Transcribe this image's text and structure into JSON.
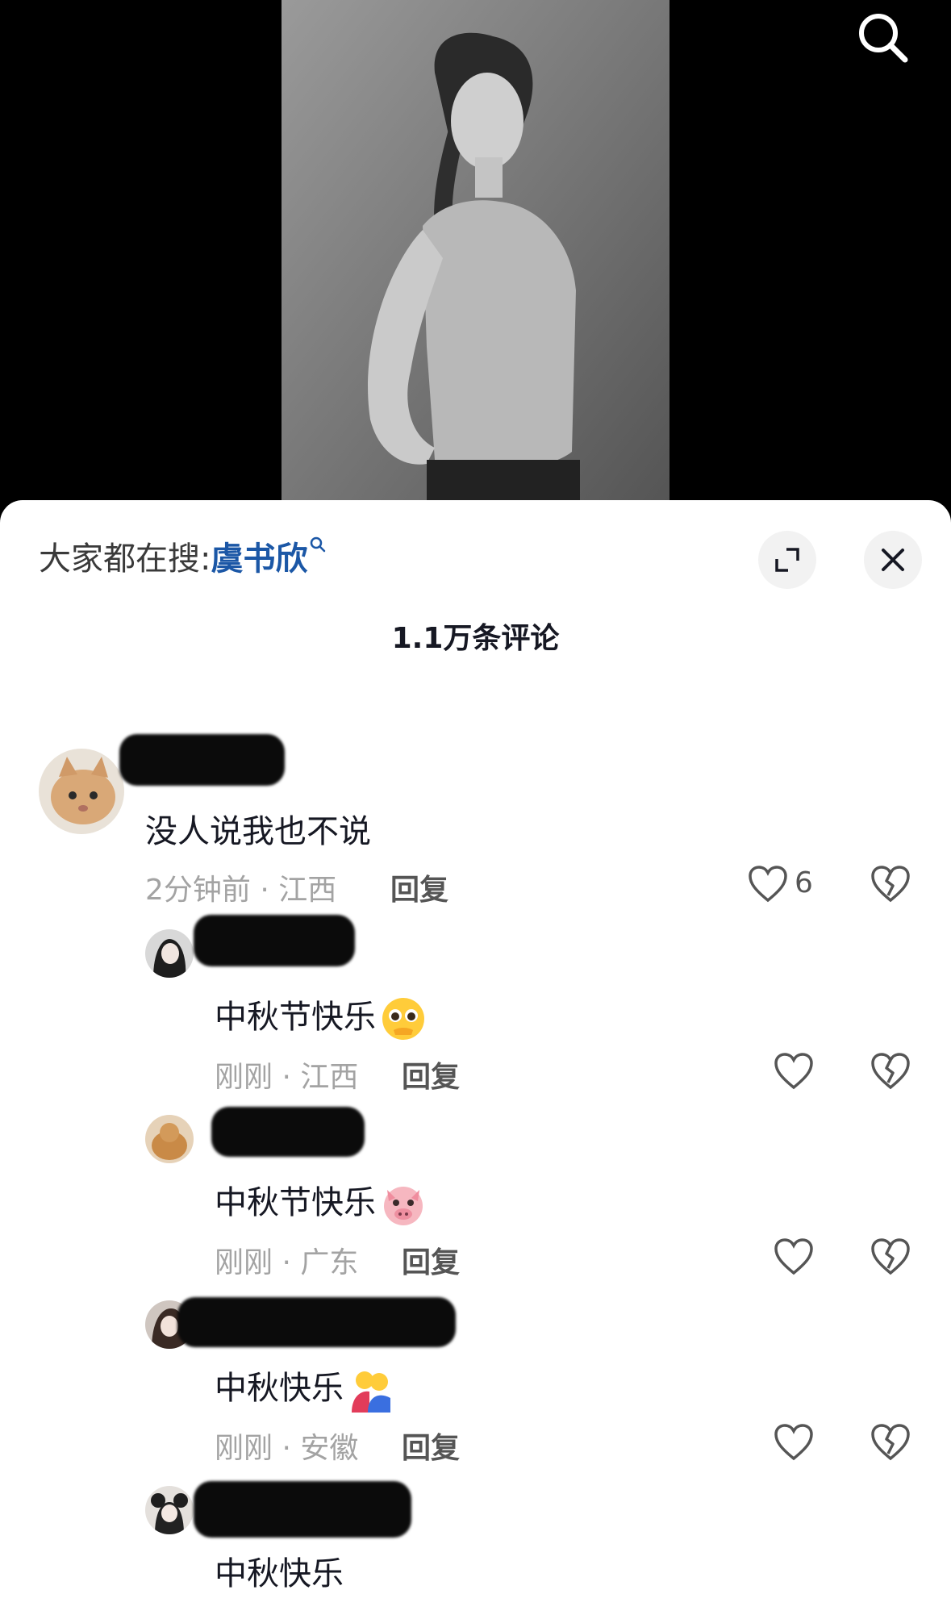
{
  "trending": {
    "prefix": "大家都在搜:",
    "keyword": "虞书欣"
  },
  "comment_count": "1.1万条评论",
  "comments": [
    {
      "text": "没人说我也不说",
      "time": "2分钟前",
      "location": "江西",
      "reply": "回复",
      "likes": "6"
    },
    {
      "text": "中秋节快乐",
      "time": "刚刚",
      "location": "江西",
      "reply": "回复"
    },
    {
      "text": "中秋节快乐",
      "time": "刚刚",
      "location": "广东",
      "reply": "回复"
    },
    {
      "text": "中秋快乐",
      "time": "刚刚",
      "location": "安徽",
      "reply": "回复"
    },
    {
      "text": "中秋快乐"
    }
  ],
  "icons": {
    "search": "search-icon",
    "expand": "expand-icon",
    "close": "close-icon",
    "like": "heart-icon",
    "dislike": "broken-heart-icon"
  },
  "colors": {
    "keyword": "#1b57a6",
    "meta": "#a3a3a3",
    "background_top": "#000000",
    "sheet": "#ffffff"
  }
}
